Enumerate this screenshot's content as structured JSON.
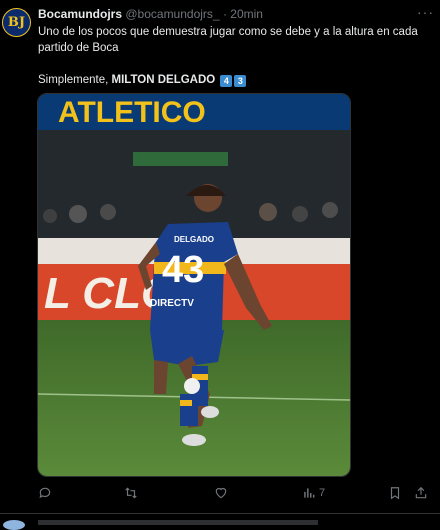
{
  "tweet": {
    "avatar_text": "BJ",
    "display_name": "Bocamundojrs",
    "handle": "@bocamundojrs_",
    "separator": "·",
    "time": "20min",
    "line1": "Uno de los pocos que demuestra jugar como se debe y a la altura en cada partido de Boca",
    "line2_prefix": "Simplemente, ",
    "line2_bold": "MILTON DELGADO",
    "keycap1": "4",
    "keycap2": "3",
    "more_label": "···",
    "media": {
      "banner_text": "ATLETICO",
      "board_text": "L CLOT",
      "jersey_name": "DELGADO",
      "jersey_number": "43",
      "sponsor": "DIRECTV"
    },
    "actions": {
      "reply_icon": "reply-icon",
      "retweet_icon": "retweet-icon",
      "like_icon": "heart-icon",
      "views_icon": "views-icon",
      "views_count": "7",
      "bookmark_icon": "bookmark-icon",
      "share_icon": "share-icon"
    }
  },
  "colors": {
    "background": "#000000",
    "text": "#e7e9ea",
    "muted": "#71767b",
    "keycap": "#3b8bd0"
  }
}
